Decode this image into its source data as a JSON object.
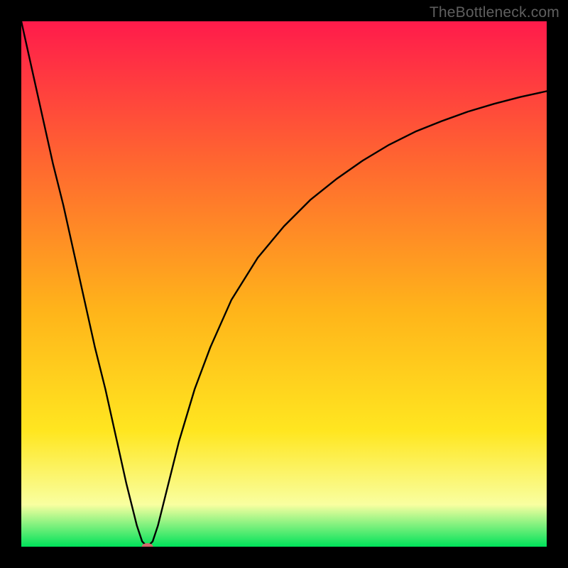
{
  "watermark": "TheBottleneck.com",
  "chart_data": {
    "type": "line",
    "title": "",
    "xlabel": "",
    "ylabel": "",
    "xlim": [
      0,
      100
    ],
    "ylim": [
      0,
      100
    ],
    "grid": false,
    "legend": false,
    "background_gradient": {
      "top_color": "#ff1b4b",
      "upper_mid_color": "#ff6a2f",
      "mid_color": "#ffb41a",
      "lower_mid_color": "#ffe620",
      "near_bottom_color": "#f9ffa0",
      "bottom_color": "#00e25a"
    },
    "series": [
      {
        "name": "bottleneck-curve",
        "color": "#000000",
        "x": [
          0,
          2,
          4,
          6,
          8,
          10,
          12,
          14,
          16,
          18,
          20,
          22,
          23,
          24,
          25,
          26,
          27,
          28,
          30,
          33,
          36,
          40,
          45,
          50,
          55,
          60,
          65,
          70,
          75,
          80,
          85,
          90,
          95,
          100
        ],
        "values": [
          100,
          91,
          82,
          73,
          65,
          56,
          47,
          38,
          30,
          21,
          12,
          4,
          1,
          0,
          1,
          4,
          8,
          12,
          20,
          30,
          38,
          47,
          55,
          61,
          66,
          70,
          73.5,
          76.5,
          79,
          81,
          82.8,
          84.3,
          85.6,
          86.7
        ]
      }
    ],
    "marker": {
      "name": "min-point",
      "x": 24,
      "y": 0,
      "color": "#d46a6a",
      "rx": 8,
      "ry": 5
    }
  }
}
